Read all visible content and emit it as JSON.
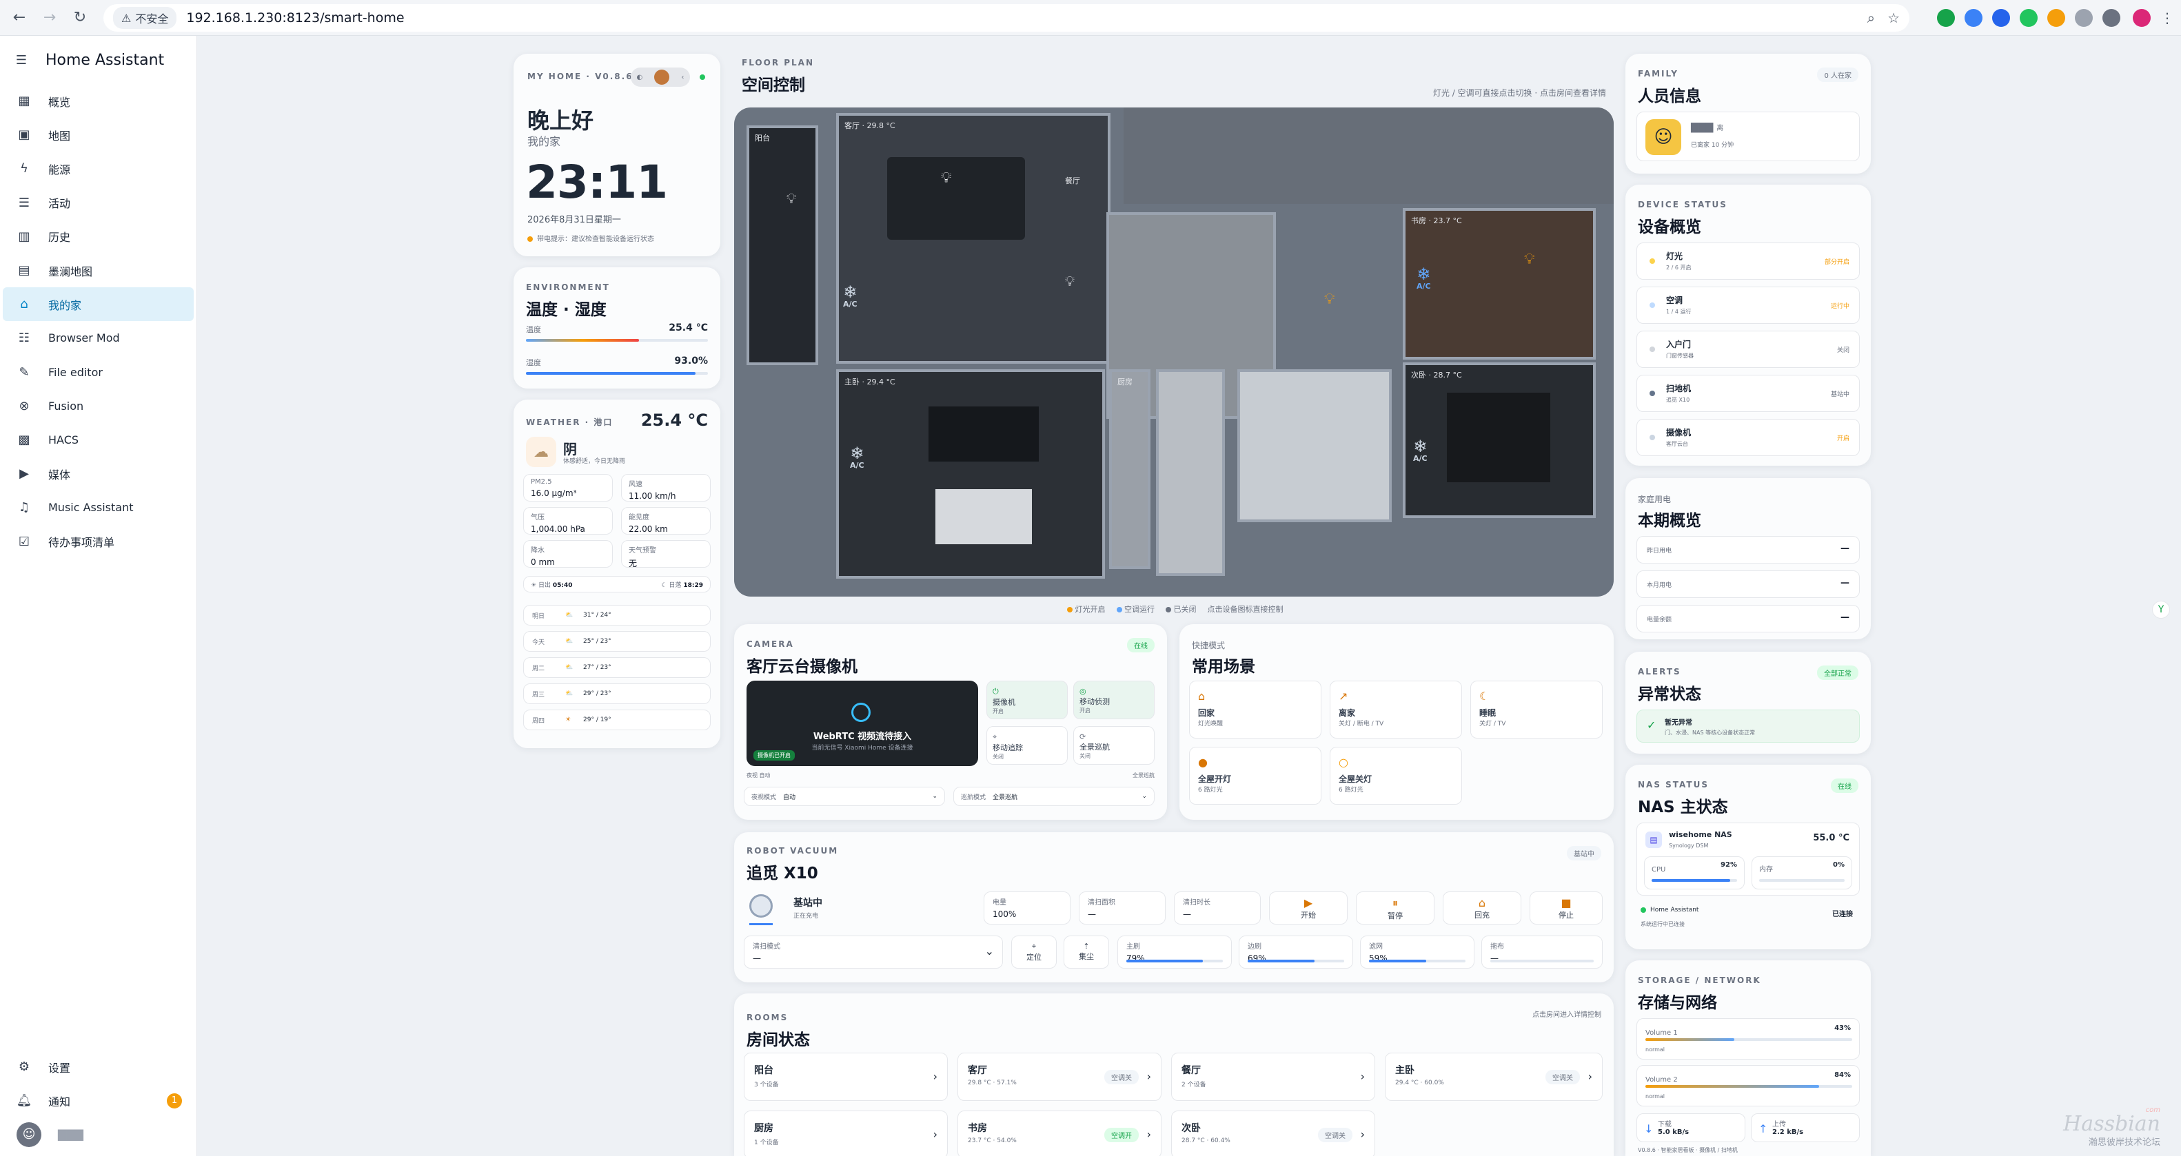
{
  "browser": {
    "insecure_label": "不安全",
    "url": "192.168.1.230:8123/smart-home"
  },
  "sidebar": {
    "title": "Home Assistant",
    "items": [
      {
        "label": "概览",
        "icon": "dashboard-icon"
      },
      {
        "label": "地图",
        "icon": "map-icon"
      },
      {
        "label": "能源",
        "icon": "lightning-icon"
      },
      {
        "label": "活动",
        "icon": "list-icon"
      },
      {
        "label": "历史",
        "icon": "chart-icon"
      },
      {
        "label": "墨澜地图",
        "icon": "map-icon"
      },
      {
        "label": "我的家",
        "icon": "home-icon"
      },
      {
        "label": "Browser Mod",
        "icon": "browser-icon"
      },
      {
        "label": "File editor",
        "icon": "wrench-icon"
      },
      {
        "label": "Fusion",
        "icon": "fusion-icon"
      },
      {
        "label": "HACS",
        "icon": "hacs-icon"
      },
      {
        "label": "媒体",
        "icon": "media-icon"
      },
      {
        "label": "Music Assistant",
        "icon": "music-icon"
      },
      {
        "label": "待办事项清单",
        "icon": "todo-icon"
      }
    ],
    "settings_label": "设置",
    "notifications_label": "通知",
    "notification_count": "1",
    "user_label": "▇▇▇"
  },
  "home": {
    "caption": "MY HOME · V0.8.6",
    "greeting": "晚上好",
    "subtitle": "我的家",
    "time": "23:11",
    "date": "2026年8月31日星期一",
    "note": "带电提示：建议检查智能设备运行状态"
  },
  "environment": {
    "caption": "ENVIRONMENT",
    "title": "温度 · 湿度",
    "temp_label": "温度",
    "temp_value": "25.4 °C",
    "temp_level": 0.62,
    "hum_label": "湿度",
    "hum_value": "93.0%",
    "hum_level": 0.93
  },
  "weather": {
    "caption": "WEATHER · 港口",
    "temp": "25.4 °C",
    "condition": "阴",
    "desc": "体感舒适，今日无降雨",
    "stats": [
      {
        "label": "PM2.5",
        "value": "16.0 µg/m³"
      },
      {
        "label": "风速",
        "value": "11.00 km/h"
      },
      {
        "label": "气压",
        "value": "1,004.00 hPa"
      },
      {
        "label": "能见度",
        "value": "22.00 km"
      },
      {
        "label": "降水",
        "value": "0 mm"
      },
      {
        "label": "天气预警",
        "value": "无"
      }
    ],
    "sunrise_label": "日出",
    "sunrise": "05:40",
    "sunset_label": "日落",
    "sunset": "18:29",
    "forecast": [
      {
        "day": "明日",
        "temp": "31° / 24°"
      },
      {
        "day": "今天",
        "temp": "25° / 23°"
      },
      {
        "day": "周二",
        "temp": "27° / 23°"
      },
      {
        "day": "周三",
        "temp": "29° / 23°"
      },
      {
        "day": "周四",
        "temp": "29° / 19°"
      }
    ]
  },
  "floorplan": {
    "caption": "FLOOR PLAN",
    "title": "空间控制",
    "hint": "灯光 / 空调可直接点击切换 · 点击房间查看详情",
    "rooms": {
      "balcony": "阳台",
      "living": "客厅 · 29.8 °C",
      "living2": "餐厅",
      "study": "书房 · 23.7 °C",
      "master": "主卧 · 29.4 °C",
      "kitchen": "厨房",
      "second": "次卧 · 28.7 °C"
    },
    "ac_label": "A/C",
    "legend": [
      {
        "label": "灯光开启",
        "color": "#f59e0b"
      },
      {
        "label": "空调运行",
        "color": "#60a5fa"
      },
      {
        "label": "已关闭",
        "color": "#6b7280"
      },
      {
        "label": "点击设备图标直接控制",
        "color": ""
      }
    ]
  },
  "camera": {
    "caption": "CAMERA",
    "title": "客厅云台摄像机",
    "status": "在线",
    "stream_title": "WebRTC 视频流待接入",
    "stream_sub": "当前无信号 Xiaomi Home 设备连接",
    "stream_badge": "摄像机已开启",
    "buttons": [
      {
        "label": "摄像机",
        "state": "开启"
      },
      {
        "label": "移动侦测",
        "state": "开启"
      },
      {
        "label": "移动追踪",
        "state": "关闭"
      },
      {
        "label": "全景巡航",
        "state": "关闭"
      }
    ],
    "footer_left": "夜视 自动",
    "footer_right": "全景巡航",
    "select1_label": "夜视模式",
    "select1_value": "自动",
    "select2_label": "巡航模式",
    "select2_value": "全景巡航"
  },
  "scenes": {
    "caption": "快捷模式",
    "title": "常用场景",
    "items": [
      {
        "name": "回家",
        "desc": "灯光唤醒"
      },
      {
        "name": "离家",
        "desc": "关灯 / 断电 / TV"
      },
      {
        "name": "睡眠",
        "desc": "关灯 / TV"
      },
      {
        "name": "全屋开灯",
        "desc": "6 路灯光"
      },
      {
        "name": "全屋关灯",
        "desc": "6 路灯光"
      }
    ]
  },
  "vacuum": {
    "caption": "ROBOT VACUUM",
    "title": "追觅 X10",
    "status_pill": "基站中",
    "state": "基站中",
    "state_sub": "正在充电",
    "stats": [
      {
        "label": "电量",
        "value": "100%"
      },
      {
        "label": "清扫面积",
        "value": "—"
      },
      {
        "label": "清扫时长",
        "value": "—"
      }
    ],
    "actions": [
      "开始",
      "暂停",
      "回充",
      "停止"
    ],
    "mode_label": "清扫模式",
    "mode_value": "—",
    "locate_label": "定位",
    "dust_label": "集尘",
    "consumables": [
      {
        "label": "主刷",
        "value": "79%",
        "level": 0.79
      },
      {
        "label": "边刷",
        "value": "69%",
        "level": 0.69
      },
      {
        "label": "滤网",
        "value": "59%",
        "level": 0.59
      },
      {
        "label": "拖布",
        "value": "—",
        "level": 0
      }
    ]
  },
  "rooms_section": {
    "caption": "ROOMS",
    "title": "房间状态",
    "hint": "点击房间进入详情控制",
    "items": [
      {
        "name": "阳台",
        "sub": "3 个设备",
        "pill": ""
      },
      {
        "name": "客厅",
        "sub": "29.8 °C · 57.1%",
        "pill": "空调关"
      },
      {
        "name": "餐厅",
        "sub": "2 个设备",
        "pill": ""
      },
      {
        "name": "主卧",
        "sub": "29.4 °C · 60.0%",
        "pill": "空调关"
      },
      {
        "name": "厨房",
        "sub": "1 个设备",
        "pill": ""
      },
      {
        "name": "书房",
        "sub": "23.7 °C · 54.0%",
        "pill": "空调开"
      },
      {
        "name": "次卧",
        "sub": "28.7 °C · 60.4%",
        "pill": "空调关"
      }
    ]
  },
  "family": {
    "caption": "FAMILY",
    "title": "人员信息",
    "pill": "0 人在家",
    "person_name": "▇▇▇",
    "person_tag": "离",
    "person_sub": "已离家 10 分钟"
  },
  "devices": {
    "caption": "DEVICE STATUS",
    "title": "设备概览",
    "items": [
      {
        "name": "灯光",
        "sub": "2 / 6 开启",
        "state": "部分开启",
        "color": "#f59e0b"
      },
      {
        "name": "空调",
        "sub": "1 / 4 运行",
        "state": "运行中",
        "color": "#f59e0b"
      },
      {
        "name": "入户门",
        "sub": "门窗传感器",
        "state": "关闭",
        "color": "#6b7280"
      },
      {
        "name": "扫地机",
        "sub": "追觅 X10",
        "state": "基站中",
        "color": "#6b7280"
      },
      {
        "name": "摄像机",
        "sub": "客厅云台",
        "state": "开启",
        "color": "#f59e0b"
      }
    ]
  },
  "energy": {
    "caption": "家庭用电",
    "title": "本期概览",
    "items": [
      {
        "label": "昨日用电",
        "value": "—"
      },
      {
        "label": "本月用电",
        "value": "—"
      },
      {
        "label": "电量余额",
        "value": "—"
      }
    ]
  },
  "alerts": {
    "caption": "ALERTS",
    "title": "异常状态",
    "pill": "全部正常",
    "ok_title": "暂无异常",
    "ok_sub": "门、水浸、NAS 等核心设备状态正常"
  },
  "nas": {
    "caption": "NAS STATUS",
    "title": "NAS 主状态",
    "pill": "在线",
    "name": "wisehome NAS",
    "model": "Synology DSM",
    "temp": "55.0 °C",
    "cpu_label": "CPU",
    "cpu_value": "92%",
    "cpu_level": 0.92,
    "mem_label": "内存",
    "mem_value": "0%",
    "mem_level": 0.0,
    "ha_label": "Home Assistant",
    "ha_sub": "系统运行中已连接",
    "ha_state": "已连接"
  },
  "storage": {
    "caption": "STORAGE / NETWORK",
    "title": "存储与网络",
    "volumes": [
      {
        "label": "Volume 1",
        "value": "43%",
        "level": 0.43,
        "status": "normal"
      },
      {
        "label": "Volume 2",
        "value": "84%",
        "level": 0.84,
        "status": "normal"
      }
    ],
    "down_label": "下载",
    "down_value": "5.0 kB/s",
    "up_label": "上传",
    "up_value": "2.2 kB/s",
    "footer": "V0.8.6 · 智能家居看板 · 摄像机 / 扫地机"
  },
  "watermark": {
    "line1": "Hassbian",
    "line2": "瀚思彼岸技术论坛",
    "line3": "com"
  }
}
